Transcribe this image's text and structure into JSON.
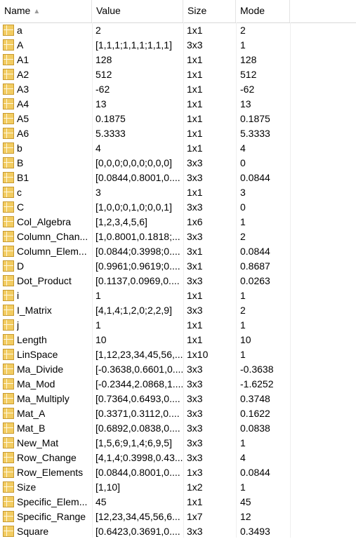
{
  "header": {
    "name_label": "Name",
    "value_label": "Value",
    "size_label": "Size",
    "mode_label": "Mode",
    "sort_icon": "sort-ascending-icon"
  },
  "rows": [
    {
      "name": "a",
      "value": "2",
      "size": "1x1",
      "mode": "2"
    },
    {
      "name": "A",
      "value": "[1,1,1;1,1,1;1,1,1]",
      "size": "3x3",
      "mode": "1"
    },
    {
      "name": "A1",
      "value": "128",
      "size": "1x1",
      "mode": "128"
    },
    {
      "name": "A2",
      "value": "512",
      "size": "1x1",
      "mode": "512"
    },
    {
      "name": "A3",
      "value": "-62",
      "size": "1x1",
      "mode": "-62"
    },
    {
      "name": "A4",
      "value": "13",
      "size": "1x1",
      "mode": "13"
    },
    {
      "name": "A5",
      "value": "0.1875",
      "size": "1x1",
      "mode": "0.1875"
    },
    {
      "name": "A6",
      "value": "5.3333",
      "size": "1x1",
      "mode": "5.3333"
    },
    {
      "name": "b",
      "value": "4",
      "size": "1x1",
      "mode": "4"
    },
    {
      "name": "B",
      "value": "[0,0,0;0,0,0;0,0,0]",
      "size": "3x3",
      "mode": "0"
    },
    {
      "name": "B1",
      "value": "[0.0844,0.8001,0....",
      "size": "3x3",
      "mode": "0.0844"
    },
    {
      "name": "c",
      "value": "3",
      "size": "1x1",
      "mode": "3"
    },
    {
      "name": "C",
      "value": "[1,0,0;0,1,0;0,0,1]",
      "size": "3x3",
      "mode": "0"
    },
    {
      "name": "Col_Algebra",
      "value": "[1,2,3,4,5,6]",
      "size": "1x6",
      "mode": "1"
    },
    {
      "name": "Column_Chan...",
      "value": "[1,0.8001,0.1818;...",
      "size": "3x3",
      "mode": "2"
    },
    {
      "name": "Column_Elem...",
      "value": "[0.0844;0.3998;0....",
      "size": "3x1",
      "mode": "0.0844"
    },
    {
      "name": "D",
      "value": "[0.9961;0.9619;0....",
      "size": "3x1",
      "mode": "0.8687"
    },
    {
      "name": "Dot_Product",
      "value": "[0.1137,0.0969,0....",
      "size": "3x3",
      "mode": "0.0263"
    },
    {
      "name": "i",
      "value": "1",
      "size": "1x1",
      "mode": "1"
    },
    {
      "name": "I_Matrix",
      "value": "[4,1,4;1,2,0;2,2,9]",
      "size": "3x3",
      "mode": "2"
    },
    {
      "name": "j",
      "value": "1",
      "size": "1x1",
      "mode": "1"
    },
    {
      "name": "Length",
      "value": "10",
      "size": "1x1",
      "mode": "10"
    },
    {
      "name": "LinSpace",
      "value": "[1,12,23,34,45,56,...",
      "size": "1x10",
      "mode": "1"
    },
    {
      "name": "Ma_Divide",
      "value": "[-0.3638,0.6601,0....",
      "size": "3x3",
      "mode": "-0.3638"
    },
    {
      "name": "Ma_Mod",
      "value": "[-0.2344,2.0868,1....",
      "size": "3x3",
      "mode": "-1.6252"
    },
    {
      "name": "Ma_Multiply",
      "value": "[0.7364,0.6493,0....",
      "size": "3x3",
      "mode": "0.3748"
    },
    {
      "name": "Mat_A",
      "value": "[0.3371,0.3112,0....",
      "size": "3x3",
      "mode": "0.1622"
    },
    {
      "name": "Mat_B",
      "value": "[0.6892,0.0838,0....",
      "size": "3x3",
      "mode": "0.0838"
    },
    {
      "name": "New_Mat",
      "value": "[1,5,6;9,1,4;6,9,5]",
      "size": "3x3",
      "mode": "1"
    },
    {
      "name": "Row_Change",
      "value": "[4,1,4;0.3998,0.43...",
      "size": "3x3",
      "mode": "4"
    },
    {
      "name": "Row_Elements",
      "value": "[0.0844,0.8001,0....",
      "size": "1x3",
      "mode": "0.0844"
    },
    {
      "name": "Size",
      "value": "[1,10]",
      "size": "1x2",
      "mode": "1"
    },
    {
      "name": "Specific_Elem...",
      "value": "45",
      "size": "1x1",
      "mode": "45"
    },
    {
      "name": "Specific_Range",
      "value": "[12,23,34,45,56,6...",
      "size": "1x7",
      "mode": "12"
    },
    {
      "name": "Square",
      "value": "[0.6423,0.3691,0....",
      "size": "3x3",
      "mode": "0.3493"
    }
  ]
}
